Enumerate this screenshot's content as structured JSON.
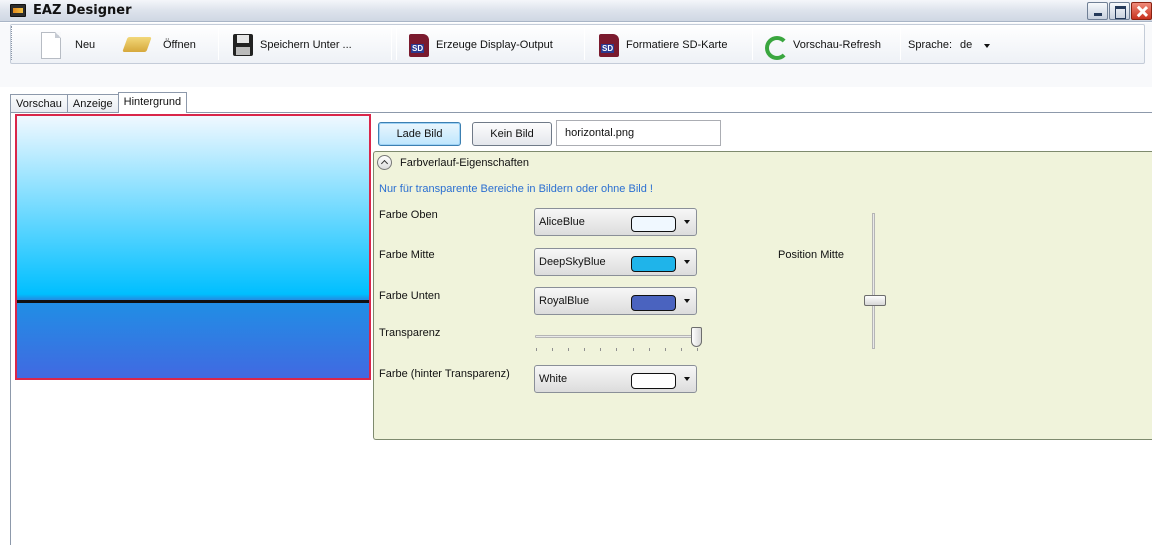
{
  "window": {
    "title": "EAZ Designer"
  },
  "toolbar": {
    "new_label": "Neu",
    "open_label": "Öffnen",
    "save_as_label": "Speichern Unter ...",
    "display_output_label": "Erzeuge Display-Output",
    "format_sd_label": "Formatiere SD-Karte",
    "refresh_label": "Vorschau-Refresh",
    "language_label": "Sprache:",
    "language_value": "de",
    "sd_icon_text": "SD"
  },
  "tabs": [
    {
      "label": "Vorschau",
      "active": false
    },
    {
      "label": "Anzeige",
      "active": false
    },
    {
      "label": "Hintergrund",
      "active": true
    }
  ],
  "background": {
    "load_image_label": "Lade Bild",
    "no_image_label": "Kein Bild",
    "image_file": "horizontal.png",
    "gradient_header": "Farbverlauf-Eigenschaften",
    "hint": "Nur für transparente Bereiche in Bildern oder ohne Bild !",
    "color_top_label": "Farbe Oben",
    "color_top_value": "AliceBlue",
    "color_top_hex": "#F0F8FF",
    "color_mid_label": "Farbe Mitte",
    "color_mid_value": "DeepSkyBlue",
    "color_mid_hex": "#1FB4EA",
    "color_bottom_label": "Farbe Unten",
    "color_bottom_value": "RoyalBlue",
    "color_bottom_hex": "#4A63BF",
    "transparency_label": "Transparenz",
    "transparency_value": 1.0,
    "behind_color_label": "Farbe (hinter Transparenz)",
    "behind_color_value": "White",
    "behind_color_hex": "#FFFFFF",
    "position_mid_label": "Position Mitte",
    "position_mid_value": 0.4
  },
  "colors": {
    "preview_border": "#D9264A",
    "group_background": "#F0F3DB",
    "hint_text": "#2B6FD1"
  }
}
